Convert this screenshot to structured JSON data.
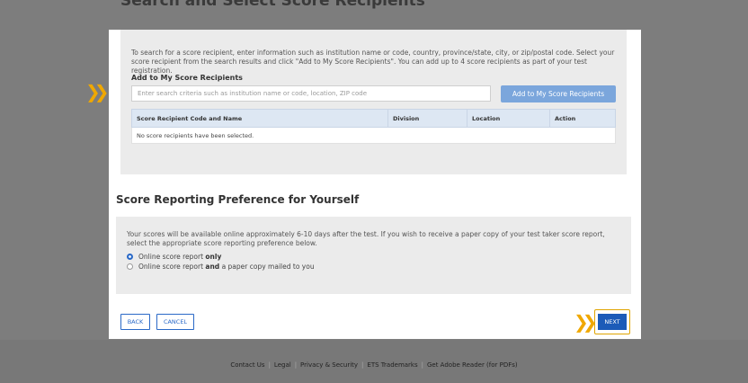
{
  "backdrop_title": "Search and Select Score Recipients",
  "search": {
    "intro": "To search for a score recipient, enter information such as institution name or code, country, province/state, city, or zip/postal code. Select your score recipient from the search results and click \"Add to My Score Recipients\". You can add up to 4 score recipients as part of your test registration.",
    "heading": "Add to My Score Recipients",
    "placeholder": "Enter search criteria such as institution name or code, location, ZIP code",
    "add_button": "Add to My Score Recipients"
  },
  "table": {
    "columns": [
      "Score Recipient Code and Name",
      "Division",
      "Location",
      "Action"
    ],
    "empty_message": "No score recipients have been selected."
  },
  "preference": {
    "title": "Score Reporting Preference for Yourself",
    "description": "Your scores will be available online approximately 6-10 days after the test. If you wish to receive a paper copy of your test taker score report, select the appropriate score reporting preference below.",
    "option1_pre": "Online score report ",
    "option1_bold": "only",
    "option2_pre": "Online score report ",
    "option2_bold": "and",
    "option2_post": " a paper copy mailed to you",
    "selected": 1
  },
  "buttons": {
    "back": "BACK",
    "cancel": "CANCEL",
    "next": "NEXT"
  },
  "hint_icon": "double-chevron-right",
  "footer": {
    "links": [
      "Contact Us",
      "Legal",
      "Privacy & Security",
      "ETS Trademarks",
      "Get Adobe Reader (for PDFs)"
    ]
  },
  "colors": {
    "primary": "#1c5bb8",
    "accent": "#f0a800",
    "panel": "#ebebeb"
  }
}
